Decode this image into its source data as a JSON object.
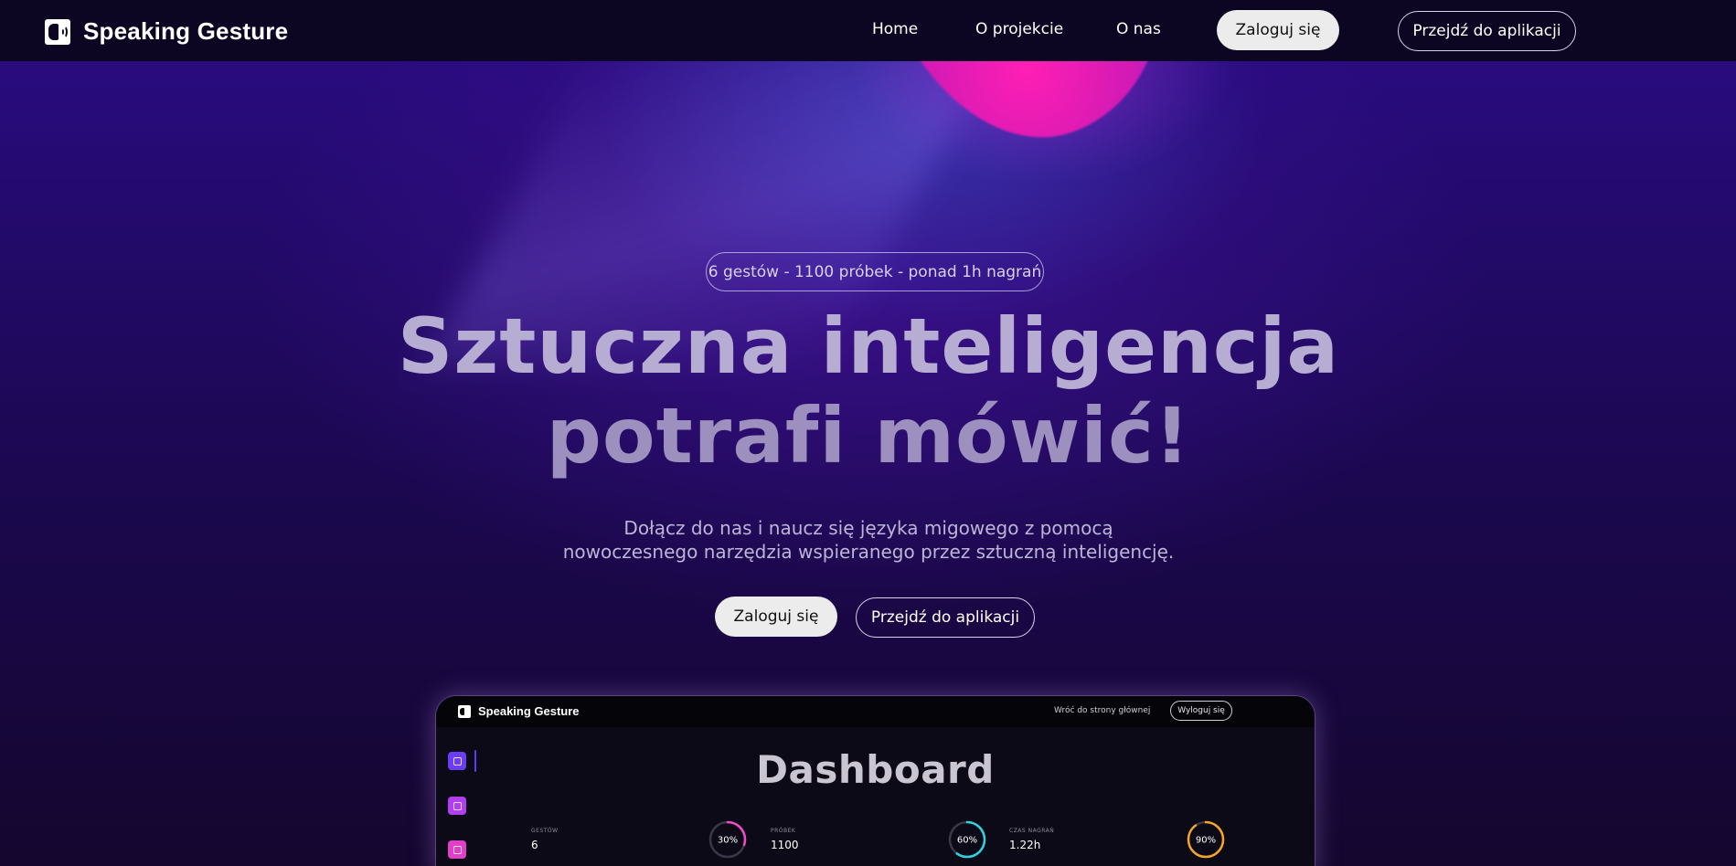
{
  "nav": {
    "brand": "Speaking Gesture",
    "links": [
      "Home",
      "O projekcie",
      "O nas"
    ],
    "login_label": "Zaloguj się",
    "app_label": "Przejdź do aplikacji"
  },
  "hero": {
    "badge": "6 gestów - 1100 próbek - ponad 1h nagrań",
    "headline_line1": "Sztuczna inteligencja",
    "headline_line2": "potrafi mówić!",
    "subtitle_line1": "Dołącz do nas i naucz się języka migowego z pomocą",
    "subtitle_line2": "nowoczesnego narzędzia wspieranego przez sztuczną inteligencję.",
    "login_label": "Zaloguj się",
    "app_label": "Przejdź do aplikacji"
  },
  "preview": {
    "brand": "Speaking Gesture",
    "back_link": "Wróć do strony głównej",
    "logout_label": "Wyloguj się",
    "title": "Dashboard",
    "stats": [
      {
        "label": "GESTÓW",
        "value": "6",
        "percent_label": "30%",
        "percent": 30,
        "color": "#f04cc8"
      },
      {
        "label": "PRÓBEK",
        "value": "1100",
        "percent_label": "60%",
        "percent": 60,
        "color": "#2fd3e0"
      },
      {
        "label": "CZAS NAGRAŃ",
        "value": "1.22h",
        "percent_label": "90%",
        "percent": 90,
        "color": "#f5a623"
      }
    ],
    "sidebar_colors": [
      "#6a3df5",
      "#b13ff0",
      "#e03fc8"
    ],
    "sidebar_icons": [
      "chart-icon",
      "gesture-icon",
      "recording-icon"
    ]
  },
  "colors": {
    "nav_bg": "#0c0622",
    "accent_pink": "#ff1fb4",
    "accent_purple": "#2c0c86"
  }
}
